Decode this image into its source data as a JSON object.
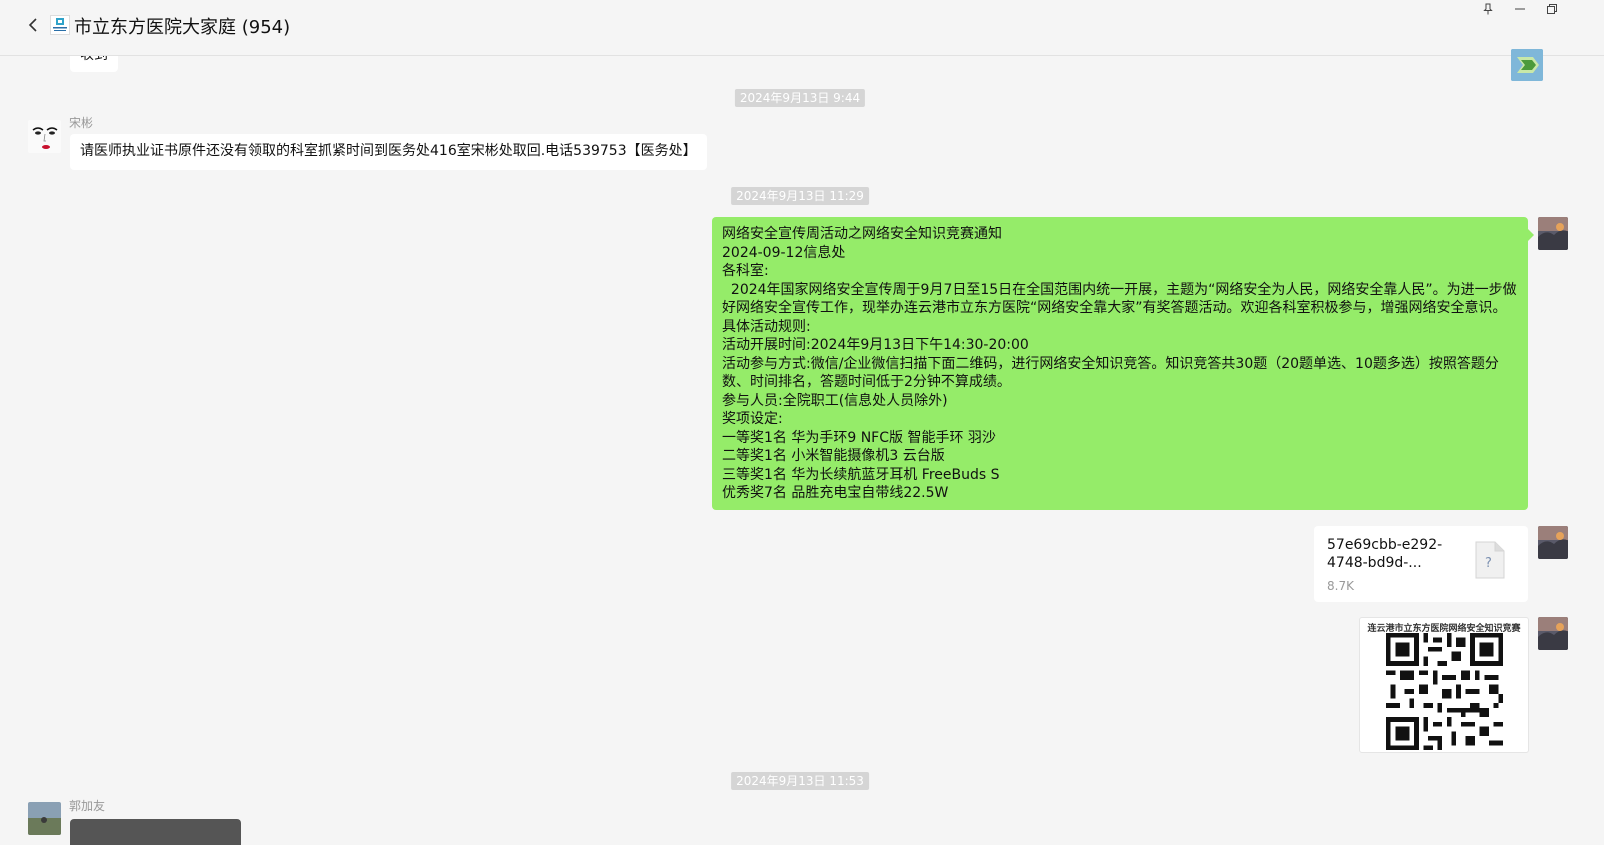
{
  "header": {
    "title": "市立东方医院大家庭 (954)"
  },
  "messages": {
    "partial_top": {
      "text": "收到"
    },
    "time1": "2024年9月13日 9:44",
    "msg1": {
      "sender": "宋彬",
      "text": "请医师执业证书原件还没有领取的科室抓紧时间到医务处416室宋彬处取回.电话539753【医务处】"
    },
    "time2": "2024年9月13日 11:29",
    "notice": {
      "lines": [
        "网络安全宣传周活动之网络安全知识竞赛通知",
        "2024-09-12信息处",
        "各科室:",
        "  2024年国家网络安全宣传周于9月7日至15日在全国范围内统一开展，主题为“网络安全为人民，网络安全靠人民”。为进一步做好网络安全宣传工作，现举办连云港市立东方医院“网络安全靠大家”有奖答题活动。欢迎各科室积极参与，增强网络安全意识。",
        "具体活动规则:",
        "活动开展时间:2024年9月13日下午14:30-20:00",
        "活动参与方式:微信/企业微信扫描下面二维码，进行网络安全知识竞答。知识竞答共30题（20题单选、10题多选）按照答题分数、时间排名，答题时间低于2分钟不算成绩。",
        "参与人员:全院职工(信息处人员除外)",
        "奖项设定:",
        "一等奖1名 华为手环9 NFC版 智能手环 羽沙",
        "二等奖1名 小米智能摄像机3 云台版",
        "三等奖1名 华为长续航蓝牙耳机 FreeBuds S",
        "优秀奖7名 品胜充电宝自带线22.5W"
      ]
    },
    "file": {
      "name": "57e69cbb-e292-4748-bd9d-...",
      "size": "8.7K",
      "icon_glyph": "?"
    },
    "qr": {
      "title": "连云港市立东方医院网络安全知识竞赛"
    },
    "time3": "2024年9月13日 11:53",
    "msg_last": {
      "sender": "郭加友"
    }
  },
  "colors": {
    "background": "#f5f5f5",
    "bubble_self": "#95ec69",
    "bubble_other": "#ffffff",
    "time_badge": "#d5d5d5"
  },
  "icons": {
    "back": "chevron-left-icon",
    "pin": "pin-icon",
    "minimize": "minimize-icon",
    "restore": "restore-window-icon",
    "file": "unknown-file-icon"
  }
}
